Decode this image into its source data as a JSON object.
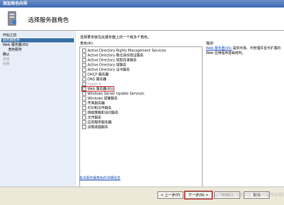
{
  "window": {
    "title": "添加角色向导"
  },
  "header": {
    "title": "选择服务器角色"
  },
  "nav": [
    {
      "label": "开始之前",
      "state": "normal"
    },
    {
      "label": "服务器角色",
      "state": "active"
    },
    {
      "label": "Web 服务器(IIS)",
      "state": "normal"
    },
    {
      "label": "角色服务",
      "state": "sub"
    },
    {
      "label": "确认",
      "state": "normal"
    },
    {
      "label": "进度",
      "state": "disabled"
    },
    {
      "label": "结果",
      "state": "disabled"
    }
  ],
  "main": {
    "description": "选择要安装在此服务器上的一个或多个角色。",
    "roles_label": "角色(R):",
    "roles": [
      {
        "label": "Active Directory Rights Management Services",
        "checked": false,
        "disabled": false
      },
      {
        "label": "Active Directory 联合身份验证服务",
        "checked": false,
        "disabled": false
      },
      {
        "label": "Active Directory 轻型目录服务",
        "checked": false,
        "disabled": false
      },
      {
        "label": "Active Directory 域服务",
        "checked": false,
        "disabled": false
      },
      {
        "label": "Active Directory 证书服务",
        "checked": false,
        "disabled": false
      },
      {
        "label": "DHCP 服务器",
        "checked": false,
        "disabled": false
      },
      {
        "label": "DNS 服务器",
        "checked": false,
        "disabled": false
      },
      {
        "label": "Hyper-V",
        "checked": false,
        "disabled": true
      },
      {
        "label": "Web 服务器(IIS)",
        "checked": true,
        "disabled": false
      },
      {
        "label": "Windows Server Update Services",
        "checked": false,
        "disabled": false
      },
      {
        "label": "Windows 部署服务",
        "checked": false,
        "disabled": false
      },
      {
        "label": "传真服务器",
        "checked": false,
        "disabled": false
      },
      {
        "label": "打印和文件服务",
        "checked": false,
        "disabled": false
      },
      {
        "label": "网络策略和访问服务",
        "checked": false,
        "disabled": false
      },
      {
        "label": "文件服务",
        "checked": false,
        "disabled": false
      },
      {
        "label": "应用程序服务器",
        "checked": false,
        "disabled": false
      },
      {
        "label": "远程桌面服务",
        "checked": false,
        "disabled": false
      }
    ],
    "info_label": "描述:",
    "info_link": "Web 服务器(IIS)",
    "info_text": "提供可靠、可管理并且可扩展的 Web 应用程序基础结构。",
    "more_link": "有关服务器角色的详细信息"
  },
  "buttons": {
    "prev": "< 上一步(P)",
    "next": "下一步(N) >",
    "install": "安装(I)",
    "cancel": "取消"
  },
  "watermark": "@稀土掘金技术社区 @杭州雷鸣运维日记"
}
